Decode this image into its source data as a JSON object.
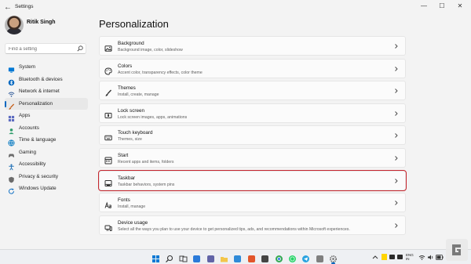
{
  "window": {
    "title": "Settings",
    "back_glyph": "←",
    "minimize_glyph": "—",
    "maximize_glyph": "☐",
    "close_glyph": "✕"
  },
  "profile": {
    "name": "Ritik Singh"
  },
  "search": {
    "placeholder": "Find a setting"
  },
  "sidebar": {
    "items": [
      {
        "label": "System",
        "icon": "monitor-icon",
        "color": "#0078d4"
      },
      {
        "label": "Bluetooth & devices",
        "icon": "bluetooth-icon",
        "color": "#0067c0"
      },
      {
        "label": "Network & internet",
        "icon": "wifi-icon",
        "color": "#2b5797"
      },
      {
        "label": "Personalization",
        "icon": "brush-icon",
        "color": "#c55a11",
        "active": true
      },
      {
        "label": "Apps",
        "icon": "apps-icon",
        "color": "#5c6bc0"
      },
      {
        "label": "Accounts",
        "icon": "person-icon",
        "color": "#2e9c6a"
      },
      {
        "label": "Time & language",
        "icon": "globe-clock-icon",
        "color": "#0a7bc2"
      },
      {
        "label": "Gaming",
        "icon": "controller-icon",
        "color": "#6b6b6b"
      },
      {
        "label": "Accessibility",
        "icon": "accessibility-icon",
        "color": "#1f6fb5"
      },
      {
        "label": "Privacy & security",
        "icon": "shield-icon",
        "color": "#6b6b6b"
      },
      {
        "label": "Windows Update",
        "icon": "refresh-icon",
        "color": "#0067c0"
      }
    ]
  },
  "main": {
    "title": "Personalization",
    "cards": [
      {
        "title": "Background",
        "subtitle": "Background image, color, slideshow",
        "icon": "image-icon"
      },
      {
        "title": "Colors",
        "subtitle": "Accent color, transparency effects, color theme",
        "icon": "palette-icon"
      },
      {
        "title": "Themes",
        "subtitle": "Install, create, manage",
        "icon": "brush-icon"
      },
      {
        "title": "Lock screen",
        "subtitle": "Lock screen images, apps, animations",
        "icon": "lock-screen-icon"
      },
      {
        "title": "Touch keyboard",
        "subtitle": "Themes, size",
        "icon": "keyboard-icon"
      },
      {
        "title": "Start",
        "subtitle": "Recent apps and items, folders",
        "icon": "start-icon"
      },
      {
        "title": "Taskbar",
        "subtitle": "Taskbar behaviors, system pins",
        "icon": "taskbar-icon",
        "highlighted": true
      },
      {
        "title": "Fonts",
        "subtitle": "Install, manage",
        "icon": "fonts-icon"
      },
      {
        "title": "Device usage",
        "subtitle": "Select all the ways you plan to use your device to get personalized tips, ads, and recommendations within Microsoft experiences.",
        "icon": "device-usage-icon"
      }
    ]
  },
  "taskbar": {
    "icons": [
      {
        "name": "start-icon",
        "color": "#0078d4"
      },
      {
        "name": "search-icon",
        "color": "#333333"
      },
      {
        "name": "task-view-icon",
        "color": "#444444"
      },
      {
        "name": "widgets-icon",
        "color": "#2a7ad9"
      },
      {
        "name": "chat-icon",
        "color": "#6264a7"
      },
      {
        "name": "file-explorer-icon",
        "color": "#f3c64b"
      },
      {
        "name": "edge-icon",
        "color": "#2f8ad8"
      },
      {
        "name": "brave-icon",
        "color": "#e2552b"
      },
      {
        "name": "store-icon",
        "color": "#444444"
      },
      {
        "name": "chrome-icon",
        "color": "#34a853"
      },
      {
        "name": "whatsapp-icon",
        "color": "#25d366"
      },
      {
        "name": "telegram-icon",
        "color": "#2aa3e0"
      },
      {
        "name": "photos-icon",
        "color": "#7f7f7f"
      },
      {
        "name": "settings-icon",
        "color": "#6b6b6b"
      }
    ],
    "tray": {
      "lang_line1": "ENG",
      "lang_line2": "IN"
    }
  },
  "accent": "#0067c0",
  "highlight_color": "#c6262e"
}
